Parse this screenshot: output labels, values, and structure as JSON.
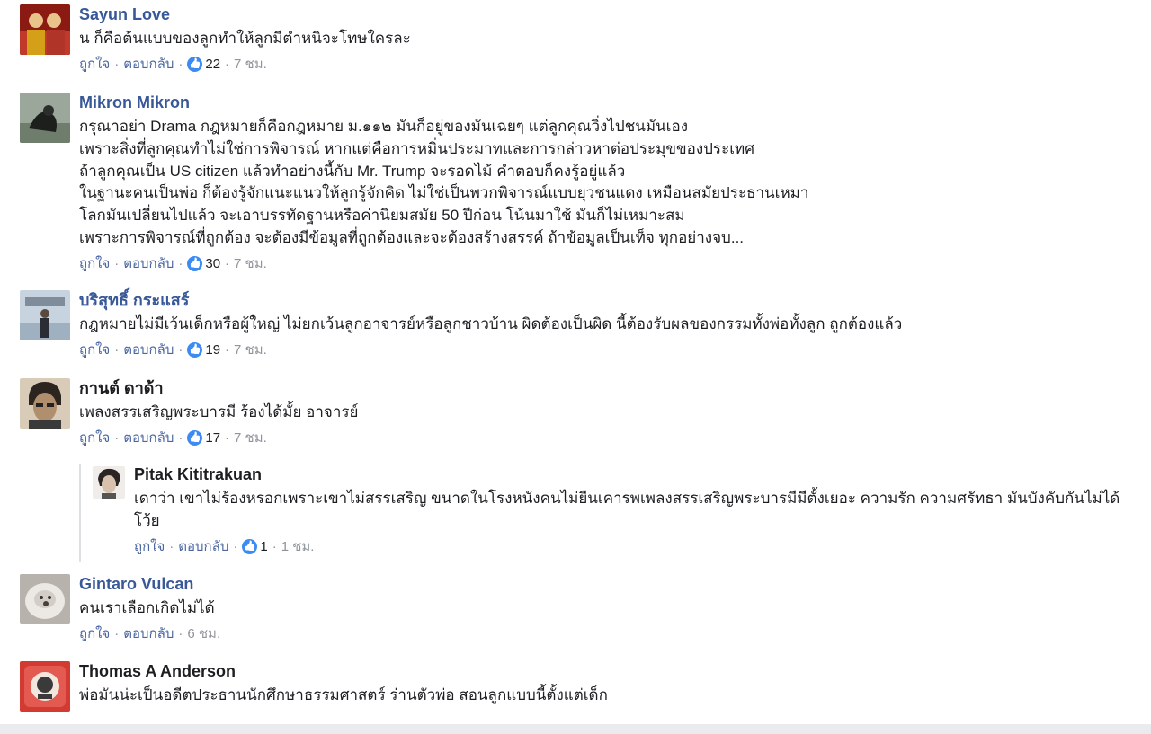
{
  "actions": {
    "like": "ถูกใจ",
    "reply": "ตอบกลับ",
    "dot": "·"
  },
  "comments": [
    {
      "name": "Sayun Love",
      "lines": [
        "น ก็คือต้นแบบของลูกทำให้ลูกมีตำหนิจะโทษใครละ"
      ],
      "likes": "22",
      "time": "7 ชม.",
      "avatar_colors": [
        "#c0392b",
        "#e8c48a"
      ]
    },
    {
      "name": "Mikron Mikron",
      "lines": [
        "กรุณาอย่า Drama กฎหมายก็คือกฎหมาย ม.๑๑๒ มันก็อยู่ของมันเฉยๆ แต่ลูกคุณวิ่งไปชนมันเอง",
        "เพราะสิ่งที่ลูกคุณทำไม่ใช่การพิจารณ์ หากแต่คือการหมิ่นประมาทและการกล่าวหาต่อประมุขของประเทศ",
        "ถ้าลูกคุณเป็น US citizen แล้วทำอย่างนี้กับ Mr. Trump จะรอดไม้ คำตอบก็คงรู้อยู่แล้ว",
        "ในฐานะคนเป็นพ่อ ก็ต้องรู้จักแนะแนวให้ลูกรู้จักคิด ไม่ใช่เป็นพวกพิจารณ์แบบยุวชนแดง เหมือนสมัยประธานเหมา",
        "โลกมันเปลี่ยนไปแล้ว จะเอาบรรทัดฐานหรือค่านิยมสมัย 50 ปีก่อน โน้นมาใช้ มันก็ไม่เหมาะสม",
        "เพราะการพิจารณ์ที่ถูกต้อง จะต้องมีข้อมูลที่ถูกต้องและจะต้องสร้างสรรค์ ถ้าข้อมูลเป็นเท็จ ทุกอย่างจบ..."
      ],
      "likes": "30",
      "time": "7 ชม.",
      "avatar_colors": [
        "#6f7d6c",
        "#1d1f1c"
      ]
    },
    {
      "name": "บริสุทธิ์ กระแสร์",
      "lines": [
        "กฎหมายไม่มีเว้นเด็กหรือผู้ใหญ่ ไม่ยกเว้นลูกอาจารย์หรือลูกชาวบ้าน ผิดต้องเป็นผิด นี้ต้องรับผลของกรรมทั้งพ่อทั้งลูก ถูกต้องแล้ว"
      ],
      "likes": "19",
      "time": "7 ชม.",
      "avatar_colors": [
        "#9fb0c1",
        "#2a2d33"
      ]
    },
    {
      "name": "กานต์ ดาด้า",
      "lines": [
        "เพลงสรรเสริญพระบารมี ร้องได้มั้ย อาจารย์"
      ],
      "likes": "17",
      "time": "7 ชม.",
      "avatar_colors": [
        "#b08f6e",
        "#2b241f"
      ]
    },
    {
      "name": "Pitak Kititrakuan",
      "lines": [
        "เดาว่า เขาไม่ร้องหรอกเพราะเขาไม่สรรเสริญ ขนาดในโรงหนังคนไม่ยืนเคารพเพลงสรรเสริญพระบารมีมีตั้งเยอะ ความรัก ความศรัทธา มันบังคับกันไม่ได้",
        "โว้ย"
      ],
      "likes": "1",
      "time": "1 ชม.",
      "avatar_colors": [
        "#d8d3cf",
        "#2a2522"
      ]
    },
    {
      "name": "Gintaro Vulcan",
      "lines": [
        "คนเราเลือกเกิดไม่ได้"
      ],
      "likes": "",
      "time": "6 ชม.",
      "avatar_colors": [
        "#c9c6c2",
        "#8a837b"
      ]
    },
    {
      "name": "Thomas A Anderson",
      "lines": [
        "พ่อมันน่ะเป็นอดีตประธานนักศึกษาธรรมศาสตร์ ร่านตัวพ่อ สอนลูกแบบนี้ตั้งแต่เด็ก"
      ],
      "likes": "",
      "time": "",
      "avatar_colors": [
        "#d33a32",
        "#3a3a3a"
      ]
    }
  ]
}
